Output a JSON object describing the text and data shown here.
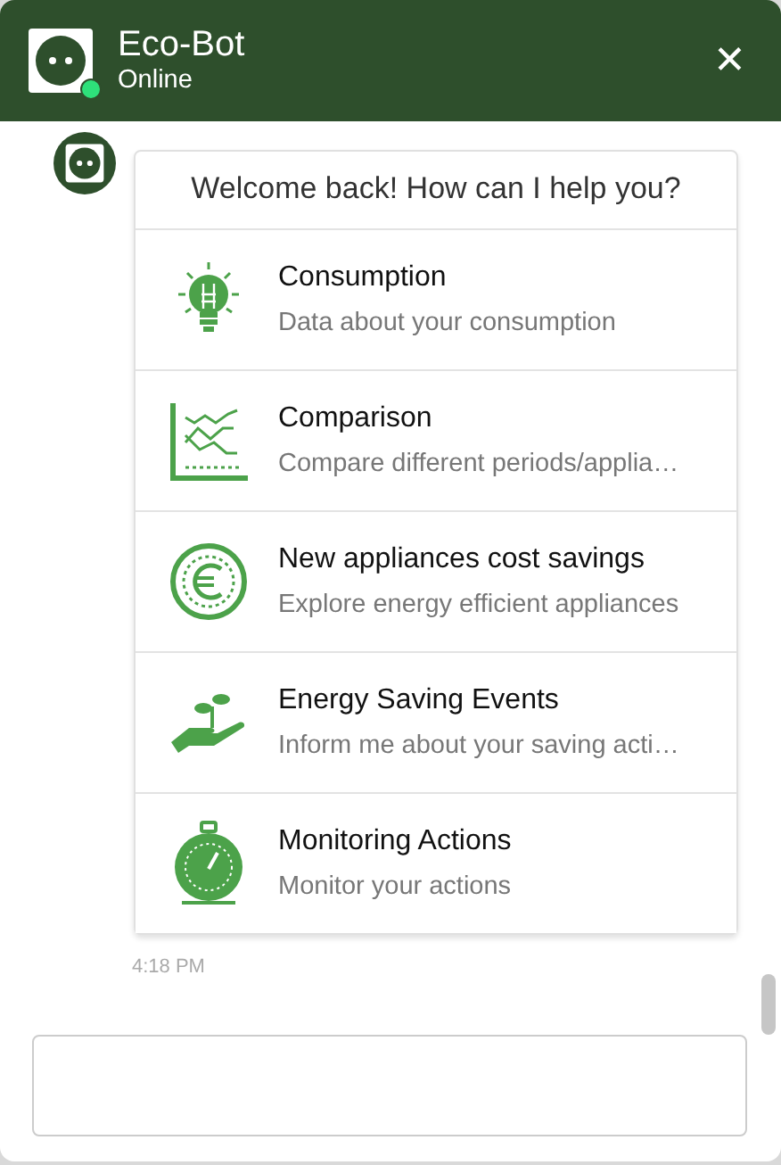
{
  "header": {
    "title": "Eco-Bot",
    "status": "Online",
    "online": true,
    "close": "✕"
  },
  "message": {
    "text": "Welcome back! How can I help you?",
    "time": "4:18 PM",
    "options": [
      {
        "kind": "bulb",
        "title": "Consumption",
        "subtitle": "Data about your consumption"
      },
      {
        "kind": "chart",
        "title": "Comparison",
        "subtitle": "Compare different periods/applia…"
      },
      {
        "kind": "coin",
        "title": "New appliances cost savings",
        "subtitle": "Explore energy efficient appliances"
      },
      {
        "kind": "plant",
        "title": "Energy Saving Events",
        "subtitle": "Inform me about your saving acti…"
      },
      {
        "kind": "stopwatch",
        "title": "Monitoring Actions",
        "subtitle": "Monitor your actions"
      }
    ]
  }
}
